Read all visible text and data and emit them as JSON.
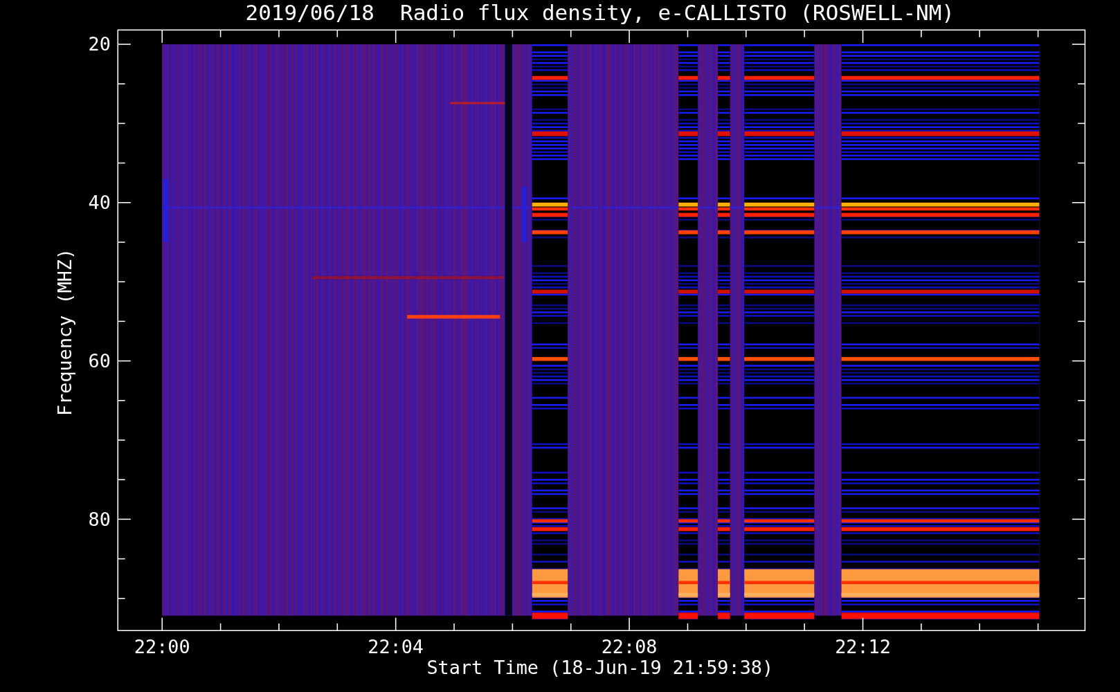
{
  "title": "2019/06/18  Radio flux density, e-CALLISTO (ROSWELL-NM)",
  "y_axis": {
    "label": "Frequency (MHZ)",
    "ticks": [
      "20",
      "40",
      "60",
      "80"
    ]
  },
  "x_axis": {
    "label": "Start Time (18-Jun-19 21:59:38)",
    "ticks": [
      "22:00",
      "22:04",
      "22:08",
      "22:12"
    ]
  }
}
